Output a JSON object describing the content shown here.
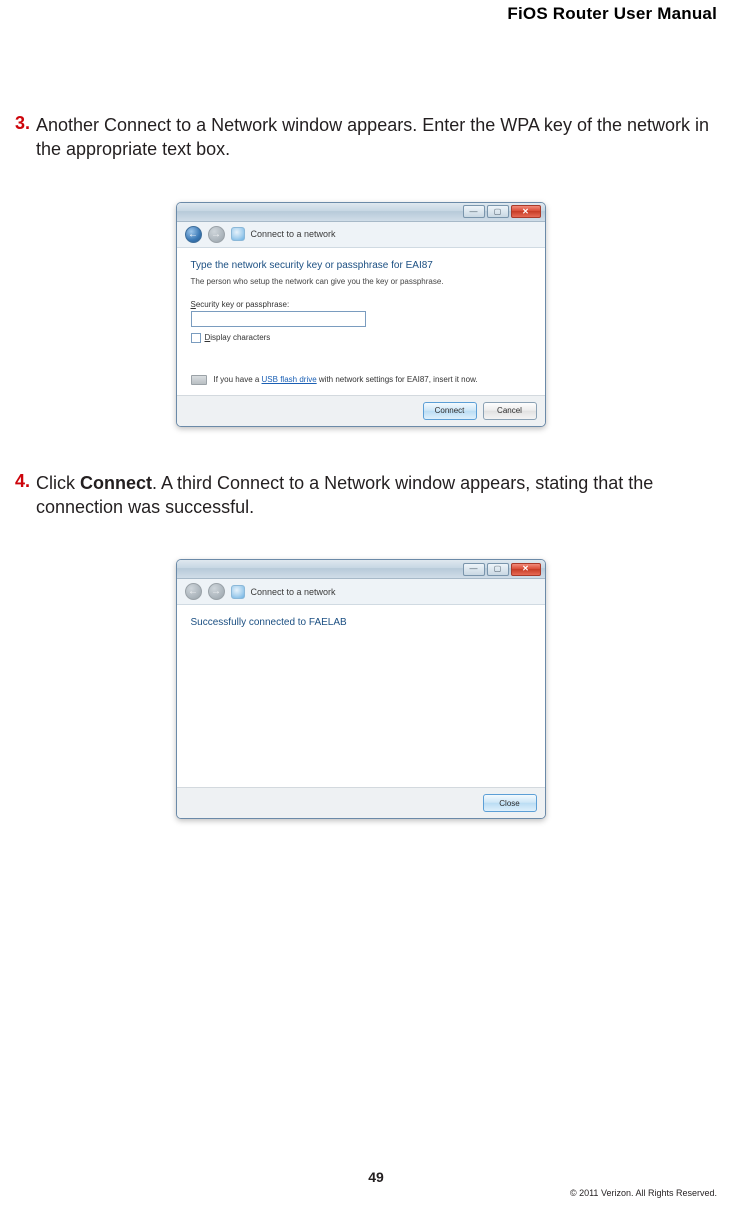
{
  "header": {
    "title": "FiOS Router User Manual"
  },
  "steps": {
    "s3": {
      "num": "3.",
      "text": "Another Connect to a Network window appears. Enter the WPA key of the network in the appropriate text box."
    },
    "s4": {
      "num": "4.",
      "prefix": "Click ",
      "bold": "Connect",
      "suffix": ". A third Connect to a Network window appears, stating that the connection was successful."
    }
  },
  "dialog1": {
    "navtitle": "Connect to a network",
    "heading": "Type the network security key or passphrase for EAI87",
    "sub": "The person who setup the network can give you the key or passphrase.",
    "field_label_pre": "S",
    "field_label_rest": "ecurity key or passphrase:",
    "display_chars_pre": "D",
    "display_chars_rest": "isplay characters",
    "usb_pre": "If you have a ",
    "usb_link": "USB flash drive",
    "usb_post": " with network settings for EAI87, insert it now.",
    "connect_btn": "Connect",
    "cancel_btn": "Cancel"
  },
  "dialog2": {
    "navtitle": "Connect to a network",
    "heading": "Successfully connected to FAELAB",
    "close_btn": "Close"
  },
  "footer": {
    "page": "49",
    "copyright": "© 2011 Verizon. All Rights Reserved."
  }
}
